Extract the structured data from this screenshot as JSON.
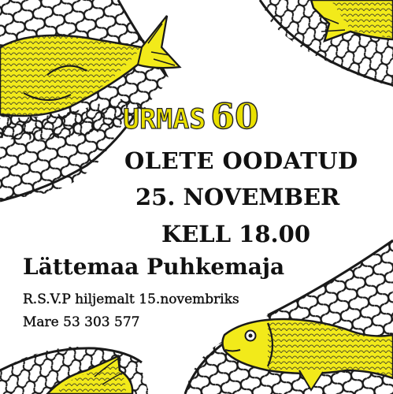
{
  "invitation": {
    "title_name": "URMAS",
    "title_age": "60",
    "welcome": "OLETE OODATUD",
    "date": "25. NOVEMBER",
    "time": "KELL 18.00",
    "venue": "Lättemaa Puhkemaja",
    "rsvp": "R.S.V.P hiljemalt 15.novembriks",
    "contact": "Mare 53 303 577"
  },
  "colors": {
    "fish_fill": "#f2ea1a",
    "accent_text": "#e9e000",
    "net_line": "#1a1a1a",
    "text": "#111111",
    "background": "#ffffff"
  },
  "illustrations": {
    "fish_icon_names": [
      "fish-top-left",
      "fish-top-right",
      "fish-bottom-right",
      "fish-bottom-left"
    ],
    "net_icon_names": [
      "net-top-left",
      "net-top-right",
      "net-bottom-right",
      "net-bottom-left"
    ]
  }
}
